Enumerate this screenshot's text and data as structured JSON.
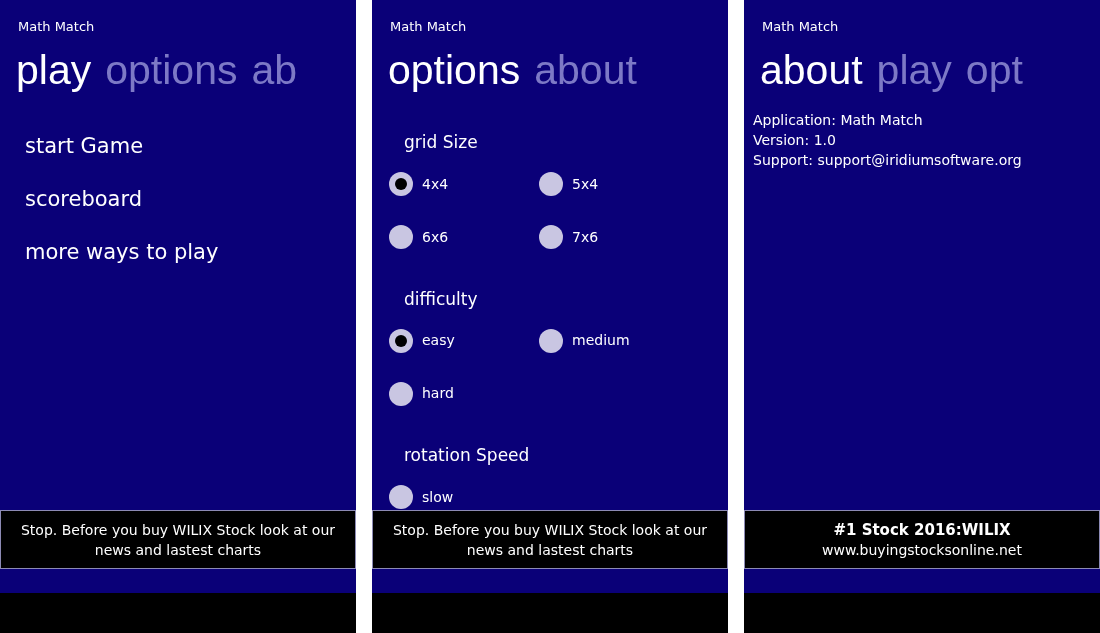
{
  "panels": [
    {
      "kind": "menu",
      "app_title": "Math Match",
      "pivot": [
        {
          "label": "play",
          "selected": true
        },
        {
          "label": "options",
          "selected": false
        },
        {
          "label": "ab",
          "selected": false
        }
      ],
      "items": [
        "start Game",
        "scoreboard",
        "more ways to play"
      ],
      "ad": {
        "kind": "text",
        "text": "Stop. Before you buy WILIX Stock look at our news and lastest charts"
      }
    },
    {
      "kind": "options",
      "app_title": "Math Match",
      "pivot": [
        {
          "label": "options",
          "selected": true
        },
        {
          "label": "about",
          "selected": false
        }
      ],
      "groups": [
        {
          "label": "grid Size",
          "options": [
            {
              "label": "4x4",
              "selected": true
            },
            {
              "label": "5x4",
              "selected": false
            },
            {
              "label": "6x6",
              "selected": false
            },
            {
              "label": "7x6",
              "selected": false
            }
          ]
        },
        {
          "label": "difficulty",
          "options": [
            {
              "label": "easy",
              "selected": true
            },
            {
              "label": "medium",
              "selected": false
            },
            {
              "label": "hard",
              "selected": false
            }
          ]
        },
        {
          "label": "rotation Speed",
          "options": [
            {
              "label": "slow",
              "selected": false
            }
          ]
        }
      ],
      "ad": {
        "kind": "text",
        "text": "Stop. Before you buy WILIX Stock look at our news and lastest charts"
      }
    },
    {
      "kind": "about",
      "app_title": "Math Match",
      "pivot": [
        {
          "label": "about",
          "selected": true
        },
        {
          "label": "play",
          "selected": false
        },
        {
          "label": "opt",
          "selected": false
        }
      ],
      "lines": [
        "Application: Math Match",
        "Version: 1.0",
        "Support: support@iridiumsoftware.org"
      ],
      "ad": {
        "kind": "headline",
        "headline": "#1 Stock 2016:WILIX",
        "url": "www.buyingstocksonline.net"
      }
    }
  ]
}
